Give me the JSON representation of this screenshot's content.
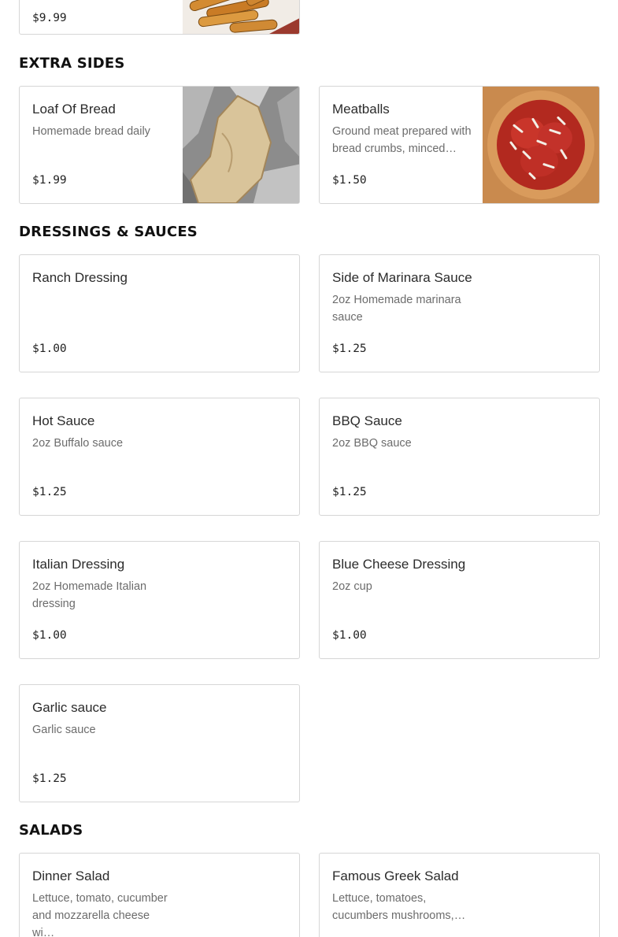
{
  "sections": {
    "extra_sides": "EXTRA SIDES",
    "dressings_sauces": "DRESSINGS & SAUCES",
    "salads": "SALADS"
  },
  "top_item": {
    "price": "$9.99",
    "image": "fried-sticks-photo"
  },
  "extra_sides": [
    {
      "name": "Loaf Of Bread",
      "desc": "Homemade bread daily",
      "price": "$1.99",
      "image": "bread-photo"
    },
    {
      "name": "Meatballs",
      "desc": "Ground meat prepared with bread crumbs, minced…",
      "price": "$1.50",
      "image": "meatballs-photo"
    }
  ],
  "dressings_sauces": [
    {
      "name": "Ranch Dressing",
      "desc": "",
      "price": "$1.00"
    },
    {
      "name": "Side of Marinara Sauce",
      "desc": "2oz Homemade marinara sauce",
      "price": "$1.25"
    },
    {
      "name": "Hot Sauce",
      "desc": "2oz Buffalo sauce",
      "price": "$1.25"
    },
    {
      "name": "BBQ Sauce",
      "desc": "2oz BBQ sauce",
      "price": "$1.25"
    },
    {
      "name": "Italian Dressing",
      "desc": "2oz Homemade Italian dressing",
      "price": "$1.00"
    },
    {
      "name": "Blue Cheese Dressing",
      "desc": "2oz cup",
      "price": "$1.00"
    },
    {
      "name": "Garlic sauce",
      "desc": "Garlic sauce",
      "price": "$1.25"
    }
  ],
  "salads": [
    {
      "name": "Dinner Salad",
      "desc": "Lettuce, tomato, cucumber and mozzarella cheese wi…"
    },
    {
      "name": "Famous Greek Salad",
      "desc": "Lettuce, tomatoes, cucumbers mushrooms,…"
    }
  ]
}
